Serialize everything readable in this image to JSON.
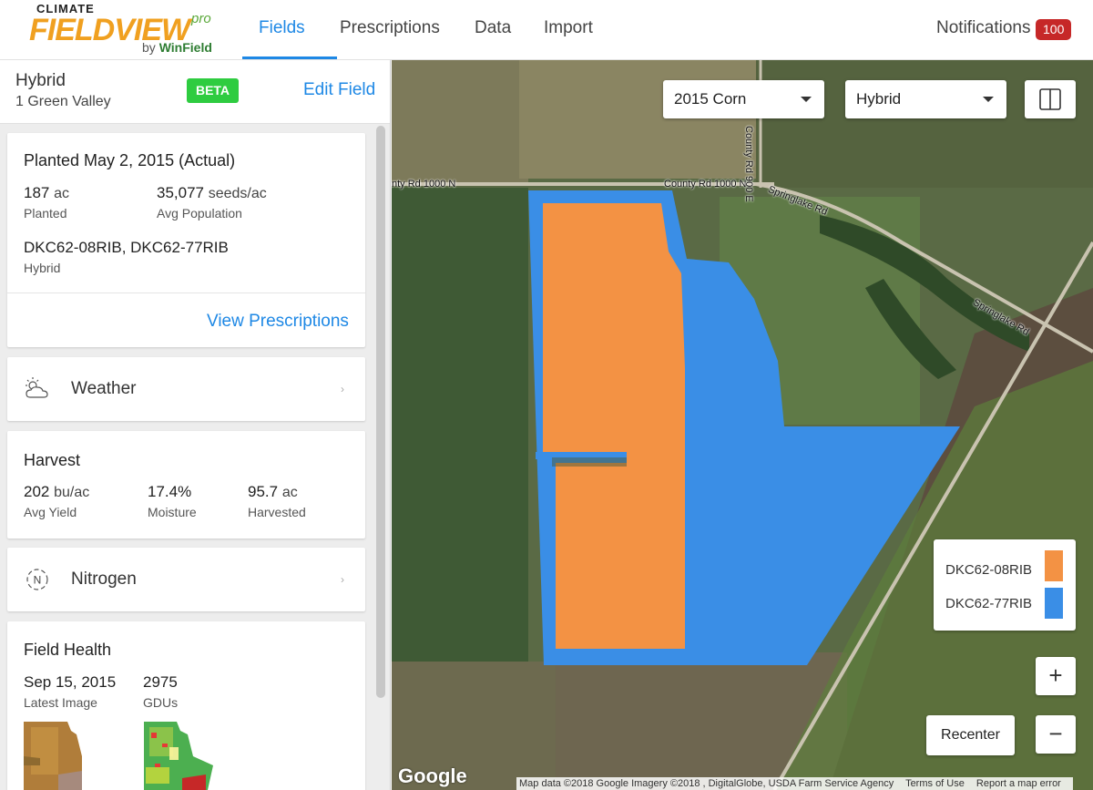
{
  "header": {
    "logo_climate": "CLIMATE",
    "logo_fieldview": "FIELDVIEW",
    "logo_pro": "pro",
    "logo_by": "by",
    "logo_winfield": "WinField",
    "nav": [
      {
        "label": "Fields",
        "active": true
      },
      {
        "label": "Prescriptions",
        "active": false
      },
      {
        "label": "Data",
        "active": false
      },
      {
        "label": "Import",
        "active": false
      }
    ],
    "notifications_label": "Notifications",
    "notifications_count": "100"
  },
  "sidebar": {
    "title": "Hybrid",
    "field_name": "1 Green Valley",
    "badge": "BETA",
    "edit_link": "Edit Field",
    "planted": {
      "title": "Planted May 2, 2015 (Actual)",
      "acres_value": "187",
      "acres_unit": "ac",
      "acres_label": "Planted",
      "population_value": "35,077",
      "population_unit": "seeds/ac",
      "population_label": "Avg Population",
      "hybrid_value": "DKC62-08RIB, DKC62-77RIB",
      "hybrid_label": "Hybrid",
      "view_link": "View Prescriptions"
    },
    "weather_label": "Weather",
    "harvest": {
      "title": "Harvest",
      "yield_value": "202",
      "yield_unit": "bu/ac",
      "yield_label": "Avg Yield",
      "moisture_value": "17.4%",
      "moisture_label": "Moisture",
      "harvested_value": "95.7",
      "harvested_unit": "ac",
      "harvested_label": "Harvested"
    },
    "nitrogen_label": "Nitrogen",
    "field_health": {
      "title": "Field Health",
      "date_value": "Sep 15, 2015",
      "date_label": "Latest Image",
      "gdu_value": "2975",
      "gdu_label": "GDUs"
    }
  },
  "map": {
    "season_select": "2015 Corn",
    "layer_select": "Hybrid",
    "legend": [
      {
        "label": "DKC62-08RIB",
        "color": "#f39244"
      },
      {
        "label": "DKC62-77RIB",
        "color": "#3a8ee6"
      }
    ],
    "recenter_label": "Recenter",
    "zoom_in": "+",
    "zoom_out": "−",
    "roads": {
      "county_rd_left": "nty Rd 1000 N",
      "county_rd_mid": "County Rd 1000 N",
      "springlake_top": "Springlake Rd",
      "springlake_right": "Springlake Rd",
      "county_rd_900": "County Rd 900 E"
    },
    "google_logo": "Google",
    "attribution": {
      "data": "Map data ©2018 Google Imagery ©2018 , DigitalGlobe, USDA Farm Service Agency",
      "terms": "Terms of Use",
      "report": "Report a map error"
    }
  }
}
